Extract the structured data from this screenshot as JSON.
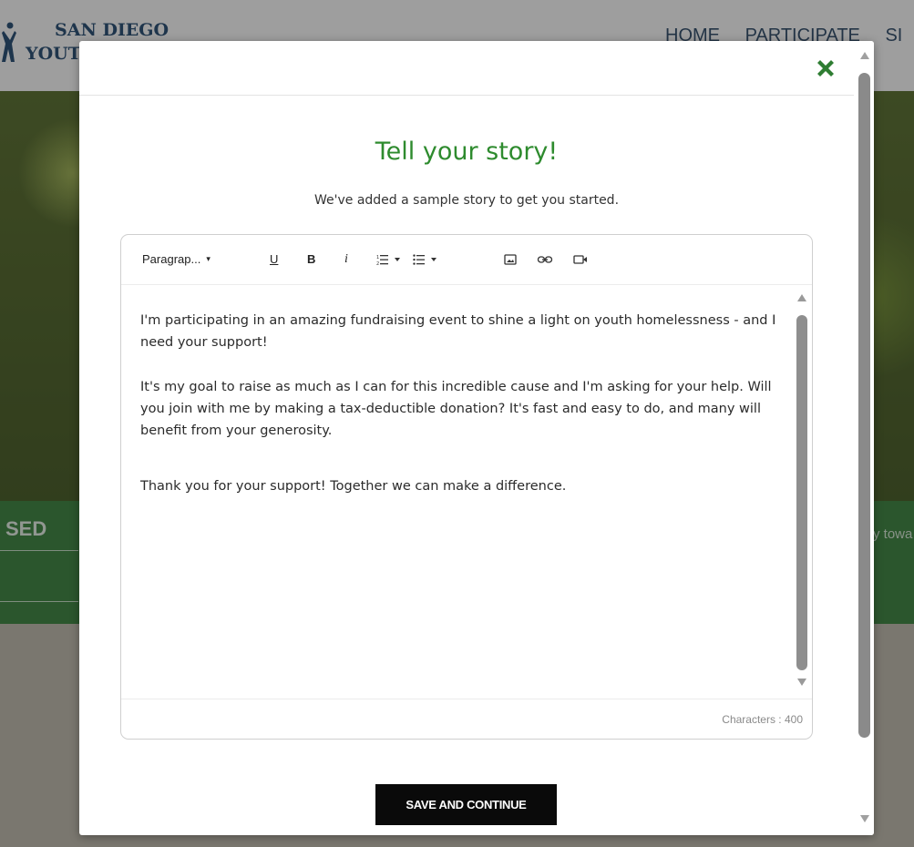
{
  "background": {
    "logo": {
      "line1": "SAN DIEGO",
      "line2": "YOUT"
    },
    "nav": [
      "HOME",
      "PARTICIPATE",
      "SI"
    ],
    "raised_label": "SED",
    "side_text": "y towa"
  },
  "modal": {
    "close_icon": "close-x-icon",
    "title": "Tell your story!",
    "subtitle": "We've added a sample story to get you started.",
    "toolbar": {
      "paragraph_label": "Paragrap...",
      "paragraph_caret": "▾",
      "underline": "U",
      "bold": "B",
      "italic": "i",
      "icons": [
        "ordered-list-icon",
        "bullet-list-icon",
        "image-icon",
        "link-icon",
        "video-icon"
      ]
    },
    "story": {
      "paragraphs": [
        "I'm participating in an amazing fundraising event to shine a light on youth homelessness - and I need your support!",
        "It's my goal to raise as much as I can for this incredible cause and I'm asking for your help. Will you join with me by making a tax-deductible donation? It's fast and easy to do, and many will benefit from your generosity.",
        "Thank you for your support! Together we can make a difference."
      ]
    },
    "character_count": "Characters : 400",
    "save_button": "SAVE AND CONTINUE"
  },
  "colors": {
    "title": "#2e8b2e",
    "close_icon": "#2e7d32",
    "button_bg": "#0a0a0a",
    "brand_navy": "#17406b",
    "brand_green": "#2e7d32"
  }
}
